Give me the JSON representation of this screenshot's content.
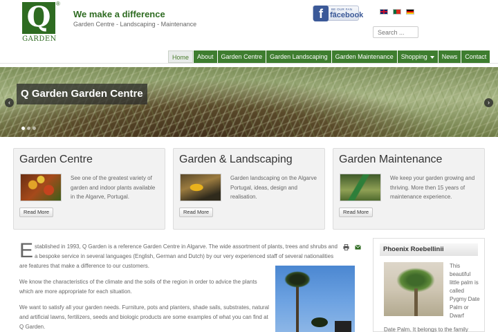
{
  "header": {
    "logo_letter": "Q",
    "logo_text": "GARDEN",
    "logo_reg": "®",
    "tagline": "We make a difference",
    "subtagline": "Garden Centre - Landscaping - Maintenance",
    "facebook": {
      "small_text": "BE OUR FAN ON",
      "word": "facebook",
      "letter": "f"
    },
    "search_placeholder": "Search ..."
  },
  "languages": [
    "English",
    "Portuguese",
    "German"
  ],
  "nav": {
    "items": [
      "Home",
      "About",
      "Garden Centre",
      "Garden Landscaping",
      "Garden Maintenance",
      "Shopping",
      "News",
      "Contact"
    ],
    "active": "Home"
  },
  "hero": {
    "caption": "Q Garden Garden Centre",
    "prev": "‹",
    "next": "›"
  },
  "features": [
    {
      "title": "Garden Centre",
      "text": "See one of the greatest variety of garden and indoor plants available in the Algarve, Portugal.",
      "button": "Read More"
    },
    {
      "title": "Garden & Landscaping",
      "text": "Garden landscaping on the Algarve Portugal, ideas, design and realisation.",
      "button": "Read More"
    },
    {
      "title": "Garden Maintenance",
      "text": "We keep your garden growing and thriving. More then 15 years of maintenance experience.",
      "button": "Read More"
    }
  ],
  "main": {
    "dropcap": "E",
    "para1": "stablished in 1993, Q Garden is a reference Garden Centre in Algarve. The wide assortment of plants, trees and shrubs and a bespoke service in several languages (English, German and Dutch) by our very experienced staff of several nationalities are features that make a difference to our customers.",
    "para2": "We know the characteristics of the climate and the soils of the region in order to advice the plants which are more appropriate for each situation.",
    "para3": "We want to satisfy all your garden needs. Furniture, pots and planters, shade sails, substrates, natural and artificial lawns, fertilizers, seeds and biologic products are some examples of what you can find at Q Garden."
  },
  "sidebar": {
    "title": "Phoenix Roebellinii",
    "text_side": "This beautiful little palm is called Pygmy Date Palm or Dwarf",
    "text_bottom": "Date Palm. It belongs to the family"
  }
}
